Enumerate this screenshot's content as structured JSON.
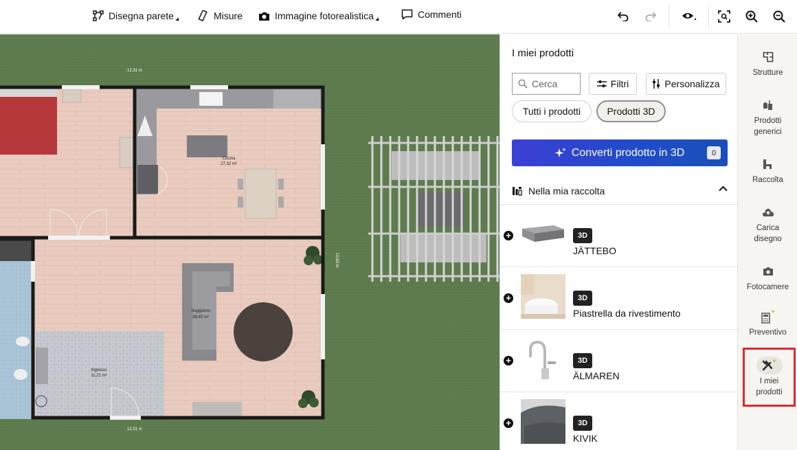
{
  "toolbar": {
    "draw_wall": "Disegna parete",
    "measures": "Misure",
    "photo_image": "Immagine fotorealistica",
    "comments": "Commenti"
  },
  "plan": {
    "dim_top": "12,31 m",
    "dim_bottom": "12,31 m",
    "dim_right": "10,63 m",
    "rooms": [
      {
        "name": "Cucina",
        "area": "27,32 m²"
      },
      {
        "name": "Soggiorno",
        "area": "39,45 m²"
      },
      {
        "name": "Ingresso",
        "area": "11,21 m²"
      }
    ]
  },
  "panel": {
    "title": "I miei prodotti",
    "search_placeholder": "Cerca",
    "filters_label": "Filtri",
    "customize_label": "Personalizza",
    "chip_all": "Tutti i prodotti",
    "chip_3d": "Prodotti 3D",
    "convert_label": "Converti prodotto in 3D",
    "convert_count": "0",
    "collection_label": "Nella mia raccolta",
    "products": [
      {
        "badge": "3D",
        "name": "JÄTTEBO",
        "icon": "sofa-thumbnail"
      },
      {
        "badge": "3D",
        "name": "Piastrella da rivestimento",
        "icon": "bathroom-tile-thumbnail"
      },
      {
        "badge": "3D",
        "name": "ÄLMAREN",
        "icon": "faucet-thumbnail"
      },
      {
        "badge": "3D",
        "name": "KIVIK",
        "icon": "armchair-thumbnail"
      }
    ]
  },
  "sidebar": {
    "items": [
      {
        "label": "Strutture",
        "icon": "structure-icon"
      },
      {
        "label": "Prodotti generici",
        "icon": "generic-products-icon"
      },
      {
        "label": "Raccolta",
        "icon": "collection-icon"
      },
      {
        "label": "Carica disegno",
        "icon": "upload-cloud-icon"
      },
      {
        "label": "Fotocamere",
        "icon": "camera-icon"
      },
      {
        "label": "Preventivo",
        "icon": "calculator-icon"
      },
      {
        "label": "I miei prodotti",
        "icon": "my-products-icon"
      }
    ]
  },
  "colors": {
    "accent_blue": "#2244cc",
    "active_outline": "#e0262e",
    "grass": "#5c7a4c",
    "floor_wood": "#e8c8bc"
  }
}
